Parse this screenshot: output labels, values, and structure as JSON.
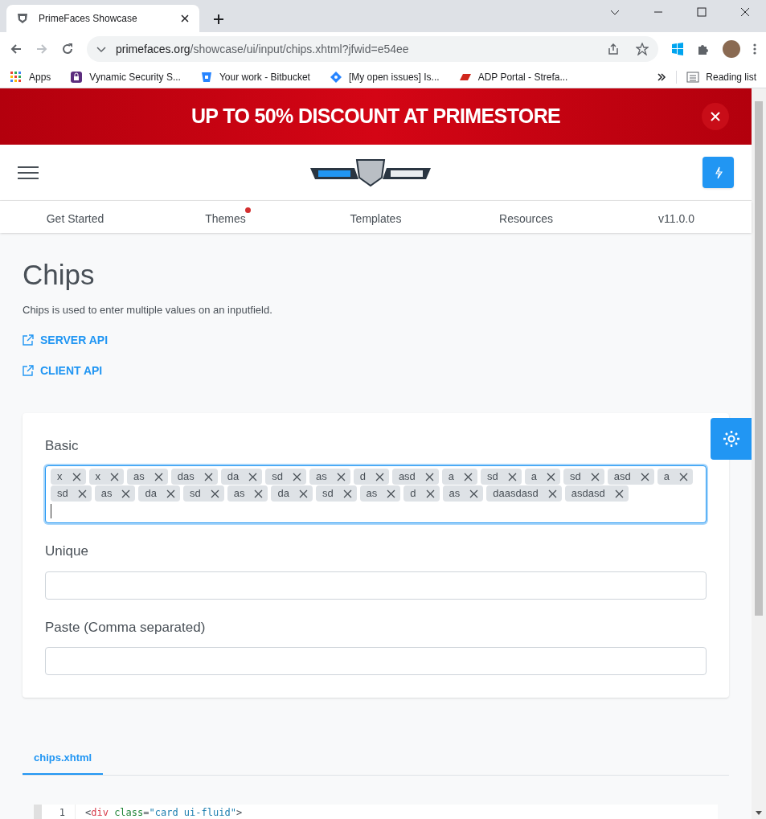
{
  "browser": {
    "tab_title": "PrimeFaces Showcase",
    "address": {
      "host": "primefaces.org",
      "path": "/showcase/ui/input/chips.xhtml?jfwid=e54ee"
    },
    "bookmarks": [
      {
        "label": "Apps"
      },
      {
        "label": "Vynamic Security S..."
      },
      {
        "label": "Your work - Bitbucket"
      },
      {
        "label": "[My open issues] Is..."
      },
      {
        "label": "ADP Portal - Strefa..."
      }
    ],
    "reading_list": "Reading list"
  },
  "banner": {
    "text": "UP TO 50% DISCOUNT AT PRIMESTORE"
  },
  "nav": [
    {
      "label": "Get Started",
      "dot": false
    },
    {
      "label": "Themes",
      "dot": true
    },
    {
      "label": "Templates",
      "dot": false
    },
    {
      "label": "Resources",
      "dot": false
    },
    {
      "label": "v11.0.0",
      "dot": false
    }
  ],
  "page": {
    "title": "Chips",
    "description": "Chips is used to enter multiple values on an inputfield.",
    "links": [
      "SERVER API",
      "CLIENT API"
    ]
  },
  "fields": [
    {
      "label": "Basic",
      "focused": true,
      "chips": [
        "x",
        "x",
        "as",
        "das",
        "da",
        "sd",
        "as",
        "d",
        "asd",
        "a",
        "sd",
        "a",
        "sd",
        "asd",
        "a",
        "sd",
        "as",
        "da",
        "sd",
        "as",
        "da",
        "sd",
        "as",
        "d",
        "as",
        "daasdasd",
        "asdasd"
      ]
    },
    {
      "label": "Unique",
      "focused": false
    },
    {
      "label": "Paste (Comma separated)",
      "focused": false
    }
  ],
  "code_tabs": [
    {
      "label": "chips.xhtml",
      "selected": true
    }
  ],
  "code_lines": [
    {
      "number": "1",
      "tokens": [
        {
          "kind": "punct",
          "text": "<"
        },
        {
          "kind": "tag",
          "text": "div"
        },
        {
          "kind": "attr",
          "text": " class"
        },
        {
          "kind": "punct",
          "text": "="
        },
        {
          "kind": "string",
          "text": "\"card ui-fluid\""
        },
        {
          "kind": "punct",
          "text": ">"
        }
      ]
    }
  ]
}
